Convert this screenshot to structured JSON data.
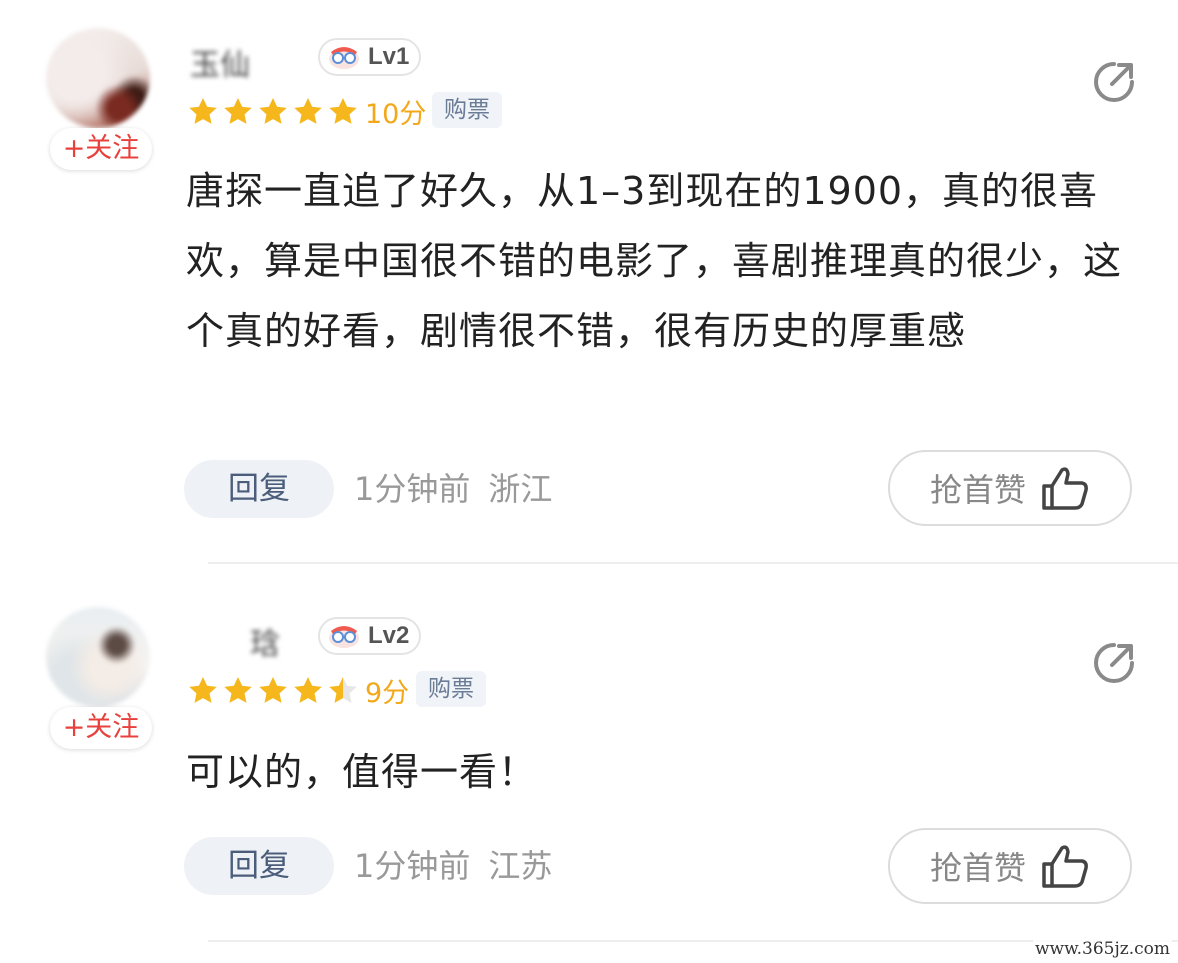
{
  "comments": [
    {
      "username": "玉仙",
      "follow_label": "+关注",
      "level": "Lv1",
      "rating_stars": 5,
      "score": "10分",
      "tag": "购票",
      "text": "唐探一直追了好久，从1–3到现在的1900，真的很喜欢，算是中国很不错的电影了，喜剧推理真的很少，这个真的好看，剧情很不错，很有历史的厚重感",
      "reply_label": "回复",
      "time": "1分钟前",
      "location": "浙江",
      "like_label": "抢首赞",
      "icons": [
        "avatar",
        "level-badge-icon",
        "star-icon",
        "share-icon",
        "thumbs-up-icon"
      ]
    },
    {
      "username": "琀",
      "follow_label": "+关注",
      "level": "Lv2",
      "rating_stars": 4.5,
      "score": "9分",
      "tag": "购票",
      "text": "可以的，值得一看！",
      "reply_label": "回复",
      "time": "1分钟前",
      "location": "江苏",
      "like_label": "抢首赞",
      "icons": [
        "avatar",
        "level-badge-icon",
        "star-icon",
        "share-icon",
        "thumbs-up-icon"
      ]
    }
  ],
  "watermark": "www.365jz.com",
  "colors": {
    "star": "#f6b71d",
    "score": "#f2a81a",
    "follow": "#e8413d",
    "tag_text": "#6a7c96",
    "reply_bg": "#eef2f7"
  }
}
